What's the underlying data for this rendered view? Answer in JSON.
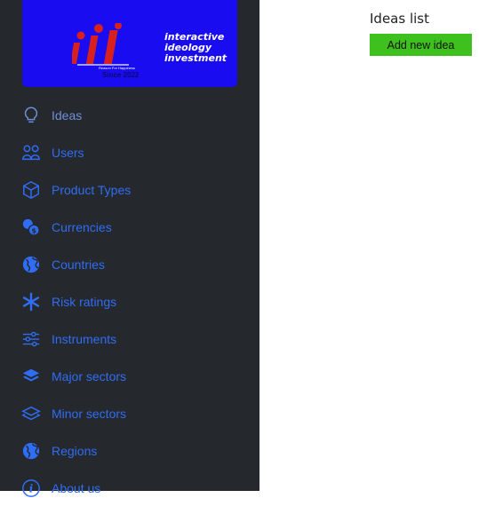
{
  "logo": {
    "line1": "interactive",
    "line2": "ideology",
    "line3": "investment",
    "tagline": "Reason For Happiness",
    "since": "Since 2022",
    "background": "#1a0cf0",
    "mark_color": "#d8201e"
  },
  "sidebar": {
    "background": "#25282c",
    "link_color": "#2f6df6",
    "active_item": "Ideas",
    "items": [
      {
        "label": "Ideas",
        "icon": "lightbulb-icon"
      },
      {
        "label": "Users",
        "icon": "users-icon"
      },
      {
        "label": "Product Types",
        "icon": "box-icon"
      },
      {
        "label": "Currencies",
        "icon": "coins-icon"
      },
      {
        "label": "Countries",
        "icon": "globe-icon"
      },
      {
        "label": "Risk ratings",
        "icon": "asterisk-icon"
      },
      {
        "label": "Instruments",
        "icon": "sliders-icon"
      },
      {
        "label": "Major sectors",
        "icon": "layers-filled-icon"
      },
      {
        "label": "Minor sectors",
        "icon": "layers-outline-icon"
      },
      {
        "label": "Regions",
        "icon": "globe-icon"
      },
      {
        "label": "About us",
        "icon": "info-icon"
      }
    ]
  },
  "main": {
    "title": "Ideas list",
    "add_button_label": "Add new idea",
    "add_button_color": "#3ec11e"
  }
}
